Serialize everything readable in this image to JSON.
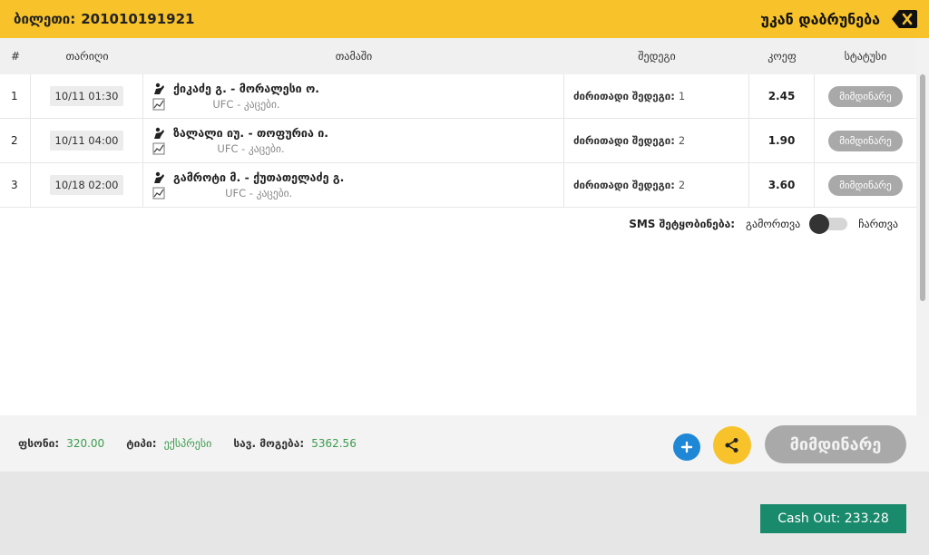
{
  "header": {
    "ticket_label": "ბილეთი:",
    "ticket_number": "201010191921",
    "back_label": "უკან დაბრუნება"
  },
  "table": {
    "columns": [
      "#",
      "თარიღი",
      "თამაში",
      "შედეგი",
      "კოეფ",
      "სტატუსი"
    ],
    "rows": [
      {
        "num": "1",
        "date": "10/11 01:30",
        "match": "ქიკაძე გ. - მორალესი ო.",
        "league": "UFC - კაცები.",
        "result_label": "ძირითადი შედეგი:",
        "result_value": "1",
        "odds": "2.45",
        "status": "მიმდინარე"
      },
      {
        "num": "2",
        "date": "10/11 04:00",
        "match": "ზალალი იუ. - თოფურია ი.",
        "league": "UFC - კაცები.",
        "result_label": "ძირითადი შედეგი:",
        "result_value": "2",
        "odds": "1.90",
        "status": "მიმდინარე"
      },
      {
        "num": "3",
        "date": "10/18 02:00",
        "match": "გამროტი მ. - ქუთათელაძე გ.",
        "league": "UFC - კაცები.",
        "result_label": "ძირითადი შედეგი:",
        "result_value": "2",
        "odds": "3.60",
        "status": "მიმდინარე"
      }
    ]
  },
  "sms": {
    "label": "SMS შეტყობინება:",
    "off": "გამორთვა",
    "on": "ჩართვა"
  },
  "footer": {
    "stake_label": "ფსონი:",
    "stake_value": "320.00",
    "type_label": "ტიპი:",
    "type_value": "ექსპრესი",
    "win_label": "სავ. მოგება:",
    "win_value": "5362.56",
    "status_button": "მიმდინარე",
    "cashout": "Cash Out: 233.28"
  },
  "colors": {
    "header": "#f7c22a",
    "accent_green": "#3a9b4c",
    "cashout": "#1a8a6d",
    "plus": "#1e87d6"
  }
}
